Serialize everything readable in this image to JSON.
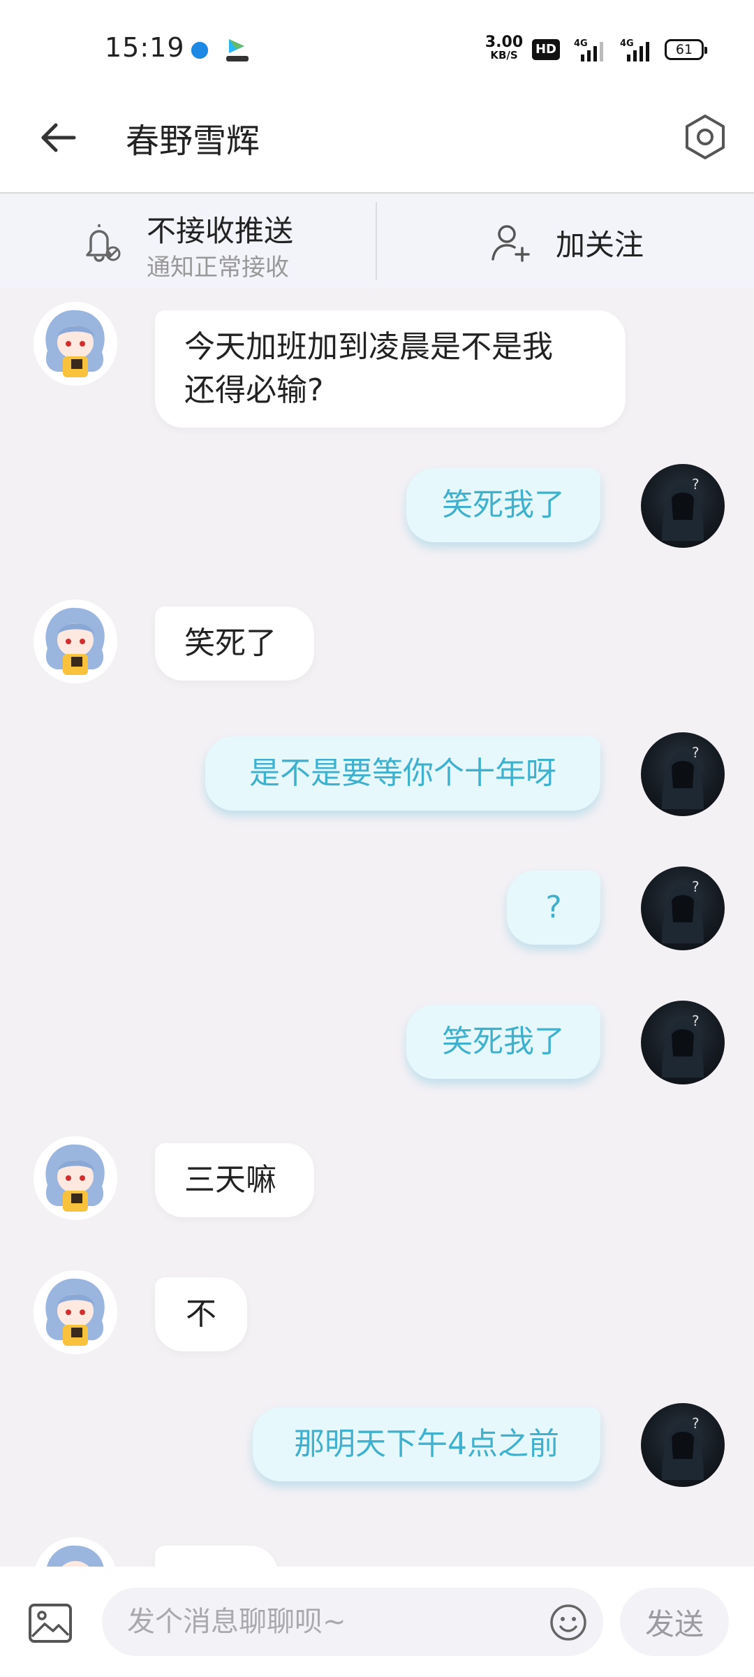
{
  "status_bar": {
    "time": "15:19",
    "network_speed_value": "3.00",
    "network_speed_unit": "KB/S",
    "hd_badge": "HD",
    "signal_1_label": "4G",
    "signal_2_label": "4G",
    "battery": "61"
  },
  "header": {
    "title": "春野雪辉",
    "back_icon": "arrow-left-icon",
    "settings_icon": "hexagon-settings-icon"
  },
  "notice": {
    "push_title": "不接收推送",
    "push_subtitle": "通知正常接收",
    "follow_label": "加关注"
  },
  "messages": [
    {
      "sender": "them",
      "text_line1": "今天加班加到凌晨是不是我",
      "text_line2": "还得必输?"
    },
    {
      "sender": "me",
      "text": "笑死我了"
    },
    {
      "sender": "them",
      "text": "笑死了"
    },
    {
      "sender": "me",
      "text": "是不是要等你个十年呀"
    },
    {
      "sender": "me",
      "text": "?"
    },
    {
      "sender": "me",
      "text": "笑死我了"
    },
    {
      "sender": "them",
      "text": "三天嘛"
    },
    {
      "sender": "them",
      "text": "不"
    },
    {
      "sender": "me",
      "text": "那明天下午4点之前"
    }
  ],
  "input_bar": {
    "placeholder": "发个消息聊聊呗~",
    "value": "",
    "send_label": "发送"
  },
  "colors": {
    "background": "#f4f1f5",
    "my_bubble": "#e6f8fb",
    "my_text": "#3fb1cf",
    "their_bubble": "#ffffff"
  }
}
